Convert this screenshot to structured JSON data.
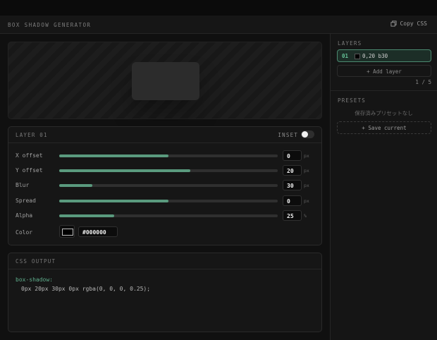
{
  "header": {
    "title": "BOX SHADOW GENERATOR",
    "copy_label": "Copy CSS"
  },
  "layer_panel": {
    "title": "LAYER 01",
    "inset_label": "INSET",
    "inset_on": false,
    "controls": [
      {
        "label": "X offset",
        "value": "0",
        "unit": "px",
        "fill_fraction": 0.5
      },
      {
        "label": "Y offset",
        "value": "20",
        "unit": "px",
        "fill_fraction": 0.6
      },
      {
        "label": "Blur",
        "value": "30",
        "unit": "px",
        "fill_fraction": 0.15
      },
      {
        "label": "Spread",
        "value": "0",
        "unit": "px",
        "fill_fraction": 0.5
      },
      {
        "label": "Alpha",
        "value": "25",
        "unit": "%",
        "fill_fraction": 0.25
      }
    ],
    "color": {
      "label": "Color",
      "hex": "#000000"
    }
  },
  "css_output": {
    "title": "CSS OUTPUT",
    "property": "box-shadow:",
    "value": "0px 20px 30px 0px rgba(0, 0, 0, 0.25);"
  },
  "sidebar": {
    "layers_title": "LAYERS",
    "layers": [
      {
        "number": "01",
        "summary": "0,20 b30",
        "color": "#000000"
      }
    ],
    "add_layer_label": "+ Add layer",
    "count": "1 / 5",
    "presets_title": "PRESETS",
    "no_presets": "保存済みプリセットなし",
    "save_label": "+ Save current"
  },
  "colors": {
    "accent": "#5a9a7e",
    "accent_text": "#65c197",
    "background": "#101010",
    "panel": "#161616"
  }
}
